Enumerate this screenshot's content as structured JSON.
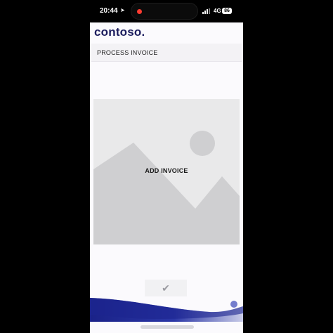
{
  "status_bar": {
    "time": "20:44",
    "network": "4G",
    "battery": "86"
  },
  "app": {
    "logo_text": "contoso.",
    "page_title": "PROCESS INVOICE"
  },
  "main": {
    "add_invoice_label": "ADD INVOICE"
  },
  "colors": {
    "brand": "#1c1d5e",
    "placeholder_bg": "#e9e9ea",
    "placeholder_shape": "#cfcfd1",
    "recording": "#ff3b30",
    "bottom_band": "#1f2b8f"
  },
  "icons": {
    "location": "location-arrow-icon",
    "signal": "signal-bars-icon",
    "check": "checkmark-icon",
    "image_placeholder": "image-placeholder-icon"
  }
}
